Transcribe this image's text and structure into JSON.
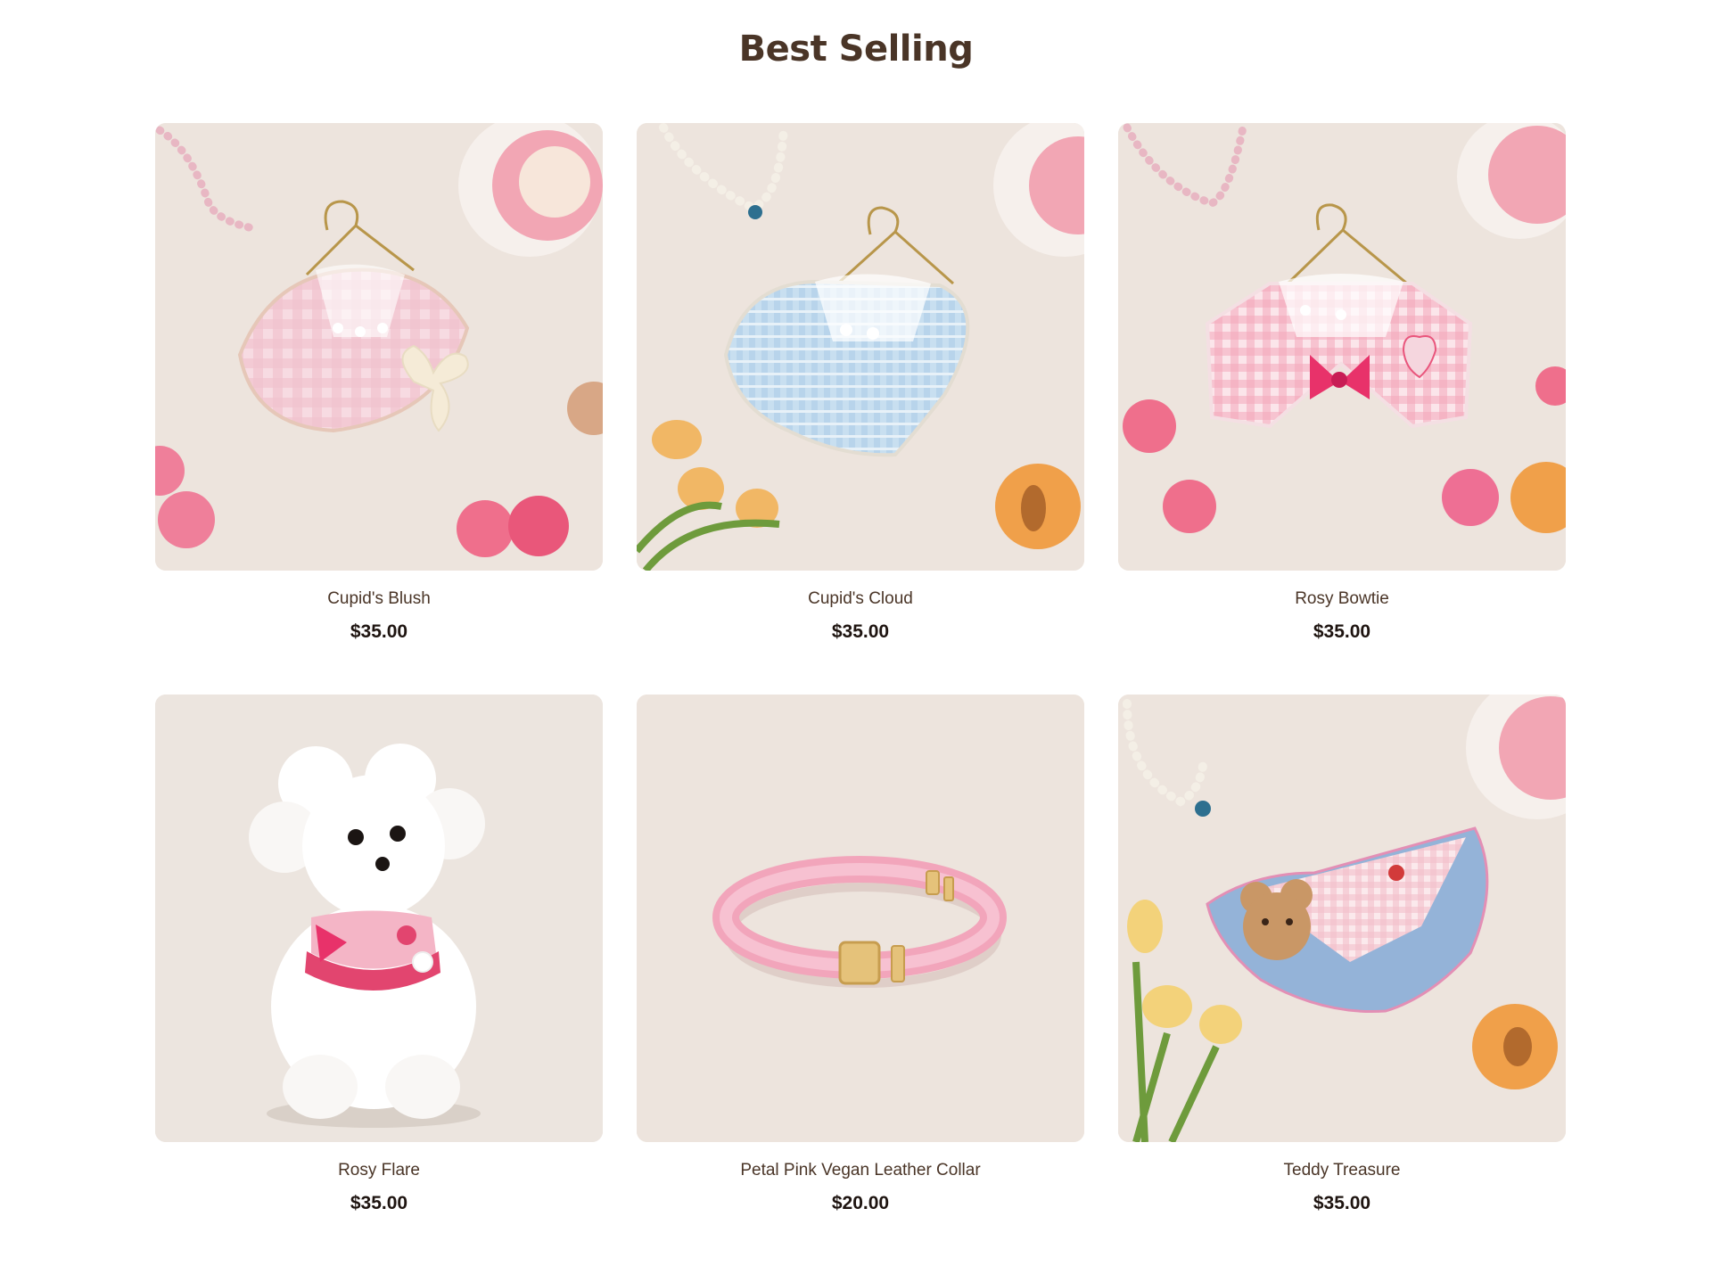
{
  "section": {
    "title": "Best Selling"
  },
  "products": [
    {
      "name": "Cupid's Blush",
      "price": "$35.00",
      "image": "pink-plaid-collar-bib-with-cream-bow-icon"
    },
    {
      "name": "Cupid's Cloud",
      "price": "$35.00",
      "image": "blue-tweed-collar-bib-icon"
    },
    {
      "name": "Rosy Bowtie",
      "price": "$35.00",
      "image": "pink-gingham-collar-with-bowtie-icon"
    },
    {
      "name": "Rosy Flare",
      "price": "$35.00",
      "image": "white-poodle-wearing-pink-bib-icon"
    },
    {
      "name": "Petal Pink Vegan Leather Collar",
      "price": "$20.00",
      "image": "pink-leather-collar-icon"
    },
    {
      "name": "Teddy Treasure",
      "price": "$35.00",
      "image": "denim-bib-with-teddy-bear-patch-icon"
    }
  ],
  "colors": {
    "title": "#4a3527",
    "card_bg": "#ede4dd",
    "price": "#1e1410"
  }
}
